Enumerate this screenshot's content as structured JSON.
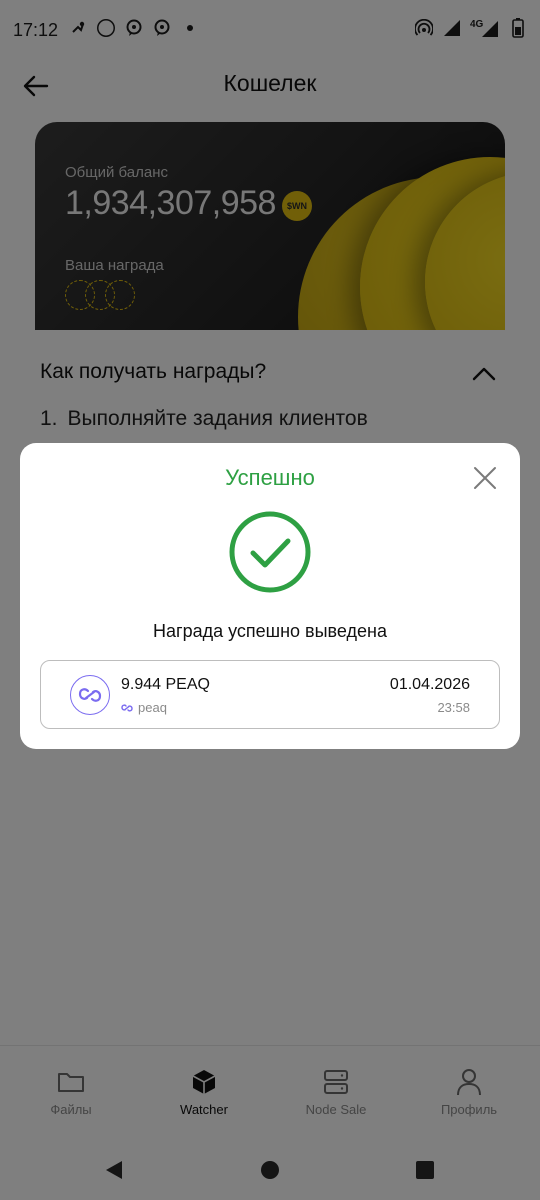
{
  "status_bar": {
    "time": "17:12",
    "left_icons": [
      "steam-icon",
      "white-circle-icon",
      "chat-bubble-icon",
      "chat-bubble-icon",
      "dot-icon"
    ],
    "network_label": "4G",
    "right_icons": [
      "hotspot-icon",
      "signal-icon",
      "4g-signal-icon",
      "battery-icon"
    ]
  },
  "header": {
    "title": "Кошелек",
    "back_icon": "arrow-left-icon"
  },
  "balance_card": {
    "total_label": "Общий баланс",
    "total_amount": "1,934,307,958",
    "currency_badge": "$WN",
    "reward_label": "Ваша награда",
    "accent_color": "#e2bf10"
  },
  "sheet": {
    "heading": "Как получать награды?",
    "step_number": "1.",
    "step_text": "Выполняйте задания клиентов хранилища"
  },
  "modal": {
    "title": "Успешно",
    "title_color": "#2ea043",
    "message": "Награда успешно выведена",
    "item": {
      "amount": "9.944 PEAQ",
      "network": "peaq",
      "date": "01.04.2026",
      "time": "23:58"
    }
  },
  "bottom_nav": {
    "items": [
      {
        "label": "Файлы",
        "icon": "folder-icon",
        "active": false
      },
      {
        "label": "Watcher",
        "icon": "cube-icon",
        "active": true
      },
      {
        "label": "Node Sale",
        "icon": "server-icon",
        "active": false
      },
      {
        "label": "Профиль",
        "icon": "user-icon",
        "active": false
      }
    ]
  },
  "system_nav": {
    "buttons": [
      "back-triangle-icon",
      "home-circle-icon",
      "recents-square-icon"
    ]
  }
}
